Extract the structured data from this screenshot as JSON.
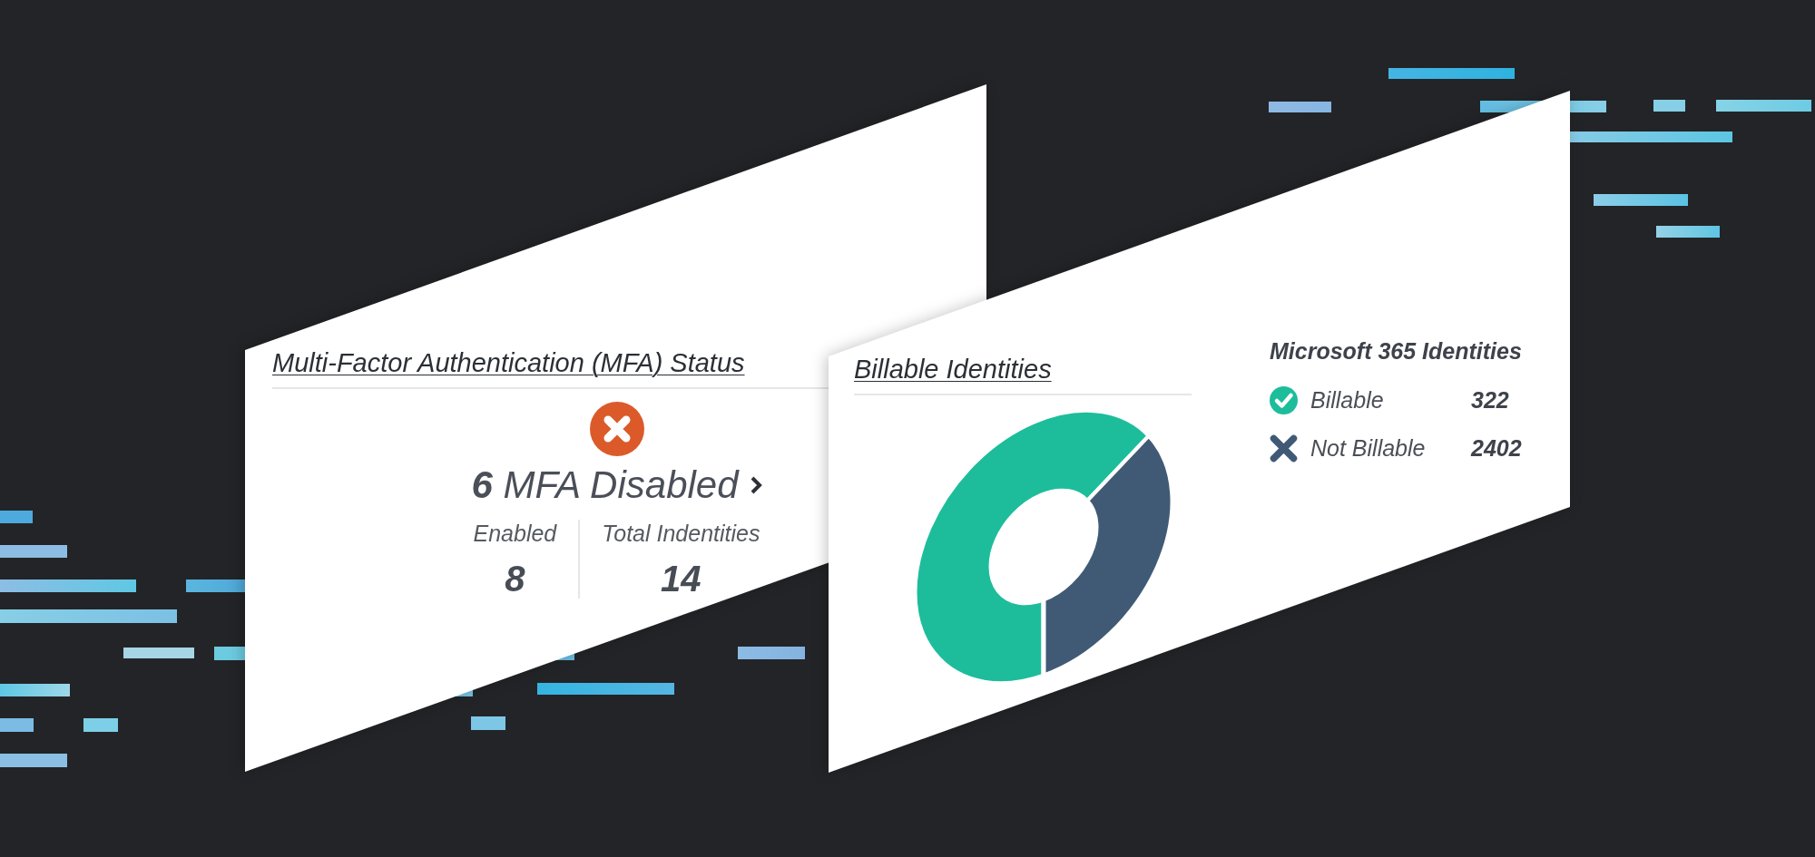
{
  "cards": [
    {
      "kind": "status",
      "title": "Multi-Factor Authentication (MFA) Status",
      "headline": "**6** MFA Disabled",
      "stats": [
        {
          "label": "Enabled",
          "value": "8"
        },
        {
          "label": "Total Indentities",
          "value": "14"
        }
      ]
    },
    {
      "kind": "donut",
      "title": "Billable Identities",
      "legend": {
        "title": "Microsoft 365 Identities",
        "items": [
          {
            "kind": "check",
            "label": "Billable",
            "value": "322",
            "color": "#1dbd9b"
          },
          {
            "kind": "cross",
            "label": "Not Billable",
            "value": "2402",
            "color": "#405a76"
          }
        ]
      }
    }
  ]
}
